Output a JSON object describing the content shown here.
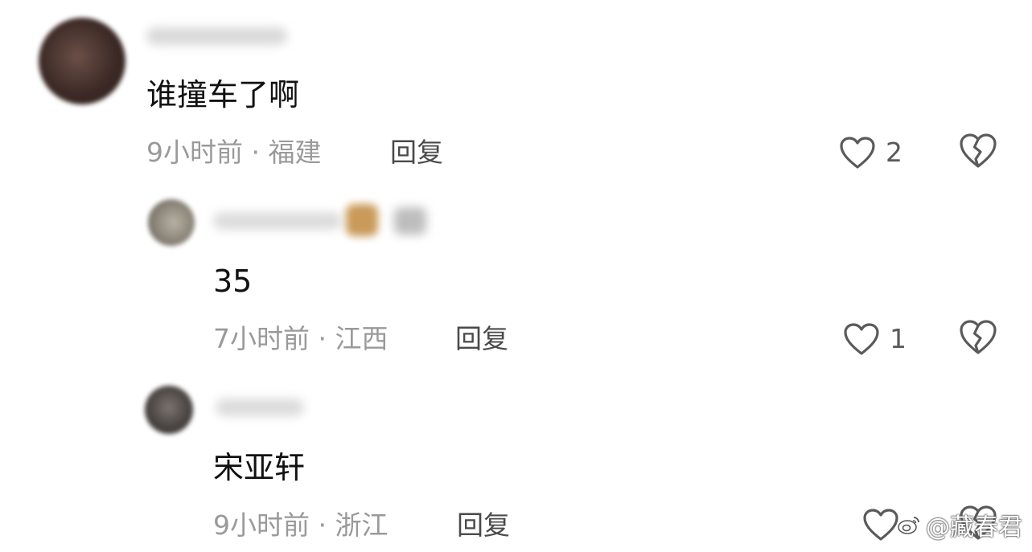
{
  "comments": [
    {
      "content": "谁撞车了啊",
      "meta": "9小时前 · 福建",
      "reply_label": "回复",
      "like_count": "2"
    },
    {
      "content": "35",
      "meta": "7小时前 · 江西",
      "reply_label": "回复",
      "like_count": "1"
    },
    {
      "content": "宋亚轩",
      "meta": "9小时前 · 浙江",
      "reply_label": "回复",
      "like_count": ""
    }
  ],
  "icons": {
    "like": "heart-outline-icon",
    "dislike": "broken-heart-icon",
    "watermark_logo": "weibo-logo-icon"
  },
  "watermark": "@藏春君",
  "colors": {
    "text": "#111111",
    "meta": "#9a9a9a",
    "reply": "#4a4a4a",
    "icon": "#5a5a5a"
  }
}
